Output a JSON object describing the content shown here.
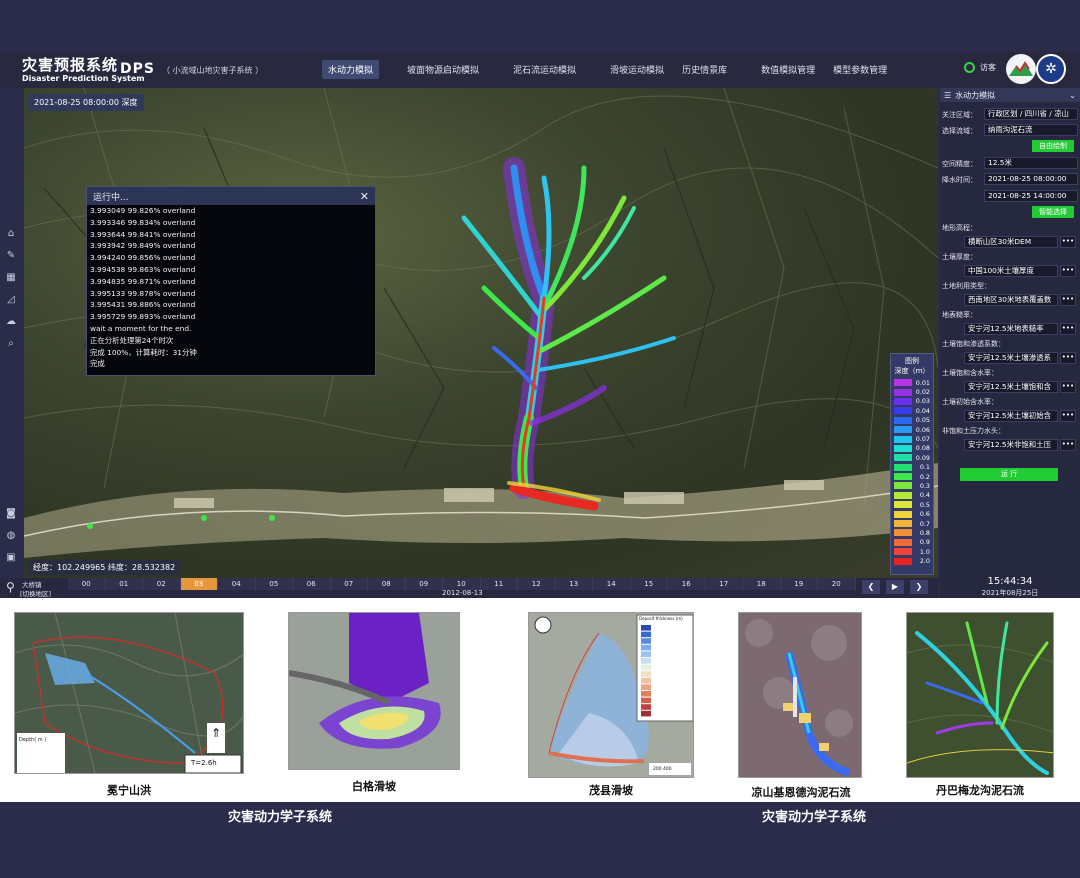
{
  "header": {
    "brand_cn": "灾害预报系统",
    "brand_en": "Disaster Prediction System",
    "product": "DPS",
    "subsystem": "（ 小流域山地灾害子系统 ）",
    "nav": [
      "水动力模拟",
      "坡面物源启动模拟",
      "泥石流运动模拟",
      "滑坡运动模拟",
      "历史情景库",
      "数值模拟管理",
      "模型参数管理"
    ],
    "user": "访客"
  },
  "map": {
    "timestamp": "2021-08-25 08:00:00  深度",
    "coords": "经度：102.249965   纬度：28.532382"
  },
  "console": {
    "title": "运行中...",
    "close": "✕",
    "lines": [
      "3.993049 99.826% overland",
      "3.993346 99.834% overland",
      "3.993644 99.841% overland",
      "3.993942 99.849% overland",
      "3.994240 99.856% overland",
      "3.994538 99.863% overland",
      "3.994835 99.871% overland",
      "3.995133 99.878% overland",
      "3.995431 99.886% overland",
      "3.995729 99.893% overland",
      "wait a moment for the end.",
      "正在分析处理第24个时次",
      "完成 100%，计算耗时：31分钟",
      "完成"
    ]
  },
  "legend": {
    "title": "图例",
    "unit": "深度（m）",
    "items": [
      {
        "label": "0.01",
        "color": "#b833e6"
      },
      {
        "label": "0.02",
        "color": "#9a2fe8"
      },
      {
        "label": "0.03",
        "color": "#6a30ee"
      },
      {
        "label": "0.04",
        "color": "#3a3af0"
      },
      {
        "label": "0.05",
        "color": "#2a6af2"
      },
      {
        "label": "0.06",
        "color": "#2a9af2"
      },
      {
        "label": "0.07",
        "color": "#22c4f0"
      },
      {
        "label": "0.08",
        "color": "#1ee0d0"
      },
      {
        "label": "0.09",
        "color": "#1ee0a0"
      },
      {
        "label": "0.1",
        "color": "#22e070"
      },
      {
        "label": "0.2",
        "color": "#3ee84a"
      },
      {
        "label": "0.3",
        "color": "#7ee83a"
      },
      {
        "label": "0.4",
        "color": "#b6e83a"
      },
      {
        "label": "0.5",
        "color": "#dfe63a"
      },
      {
        "label": "0.6",
        "color": "#f0d23a"
      },
      {
        "label": "0.7",
        "color": "#f2b43a"
      },
      {
        "label": "0.8",
        "color": "#f2903a"
      },
      {
        "label": "0.9",
        "color": "#f26a3a"
      },
      {
        "label": "1.0",
        "color": "#f0443a"
      },
      {
        "label": "2.0",
        "color": "#e62222"
      }
    ]
  },
  "timeline": {
    "layer_switch_1": "大桥镇",
    "layer_switch_2": "[切换地区]",
    "ticks": [
      "00",
      "01",
      "02",
      "03",
      "04",
      "05",
      "06",
      "07",
      "08",
      "09",
      "10",
      "11",
      "12",
      "13",
      "14",
      "15",
      "16",
      "17",
      "18",
      "19",
      "20"
    ],
    "active_index": 3,
    "date": "2012-08-13",
    "prev": "❮",
    "play": "▶",
    "next": "❯"
  },
  "panel": {
    "title": "水动力模拟",
    "caret": "⌄",
    "focus_area_label": "关注区域：",
    "focus_area_value": "行政区划 / 四川省 / 凉山",
    "basin_label": "选择流域：",
    "basin_value": "纳雨沟泥石流",
    "auto_draw": "自由绘制",
    "resolution_label": "空间精度：",
    "resolution_value": "12.5米",
    "rain_time_label": "降水时间：",
    "rain_start": "2021-08-25 08:00:00",
    "rain_end": "2021-08-25 14:00:00",
    "smart_select": "智能选择",
    "dem_label": "地形高程：",
    "dem_value": "横断山区30米DEM",
    "soil_depth_label": "土壤厚度：",
    "soil_depth_value": "中国100米土壤厚度",
    "landuse_label": "土地利用类型：",
    "landuse_value": "西南地区30米地表覆盖数",
    "roughness_label": "地表糙率：",
    "roughness_value": "安宁河12.5米地表糙率",
    "conductivity_label": "土壤饱和渗透系数：",
    "conductivity_value": "安宁河12.5米土壤渗透系",
    "sat_moisture_label": "土壤饱和含水率：",
    "sat_moisture_value": "安宁河12.5米土壤饱和含",
    "init_moisture_label": "土壤初始含水率：",
    "init_moisture_value": "安宁河12.5米土壤初始含",
    "suction_label": "非饱和土压力水头：",
    "suction_value": "安宁河12.5米非饱和土压",
    "more": "•••",
    "run": "运 行",
    "clock": "15:44:34",
    "clock_date": "2021年08月25日"
  },
  "gallery": {
    "captions": [
      "冕宁山洪",
      "白格滑坡",
      "茂县滑坡",
      "凉山基恩德沟泥石流",
      "丹巴梅龙沟泥石流"
    ],
    "thumb1_legend_title": "Depth( m )",
    "thumb1_time": "T=2.6h",
    "thumb3_legend_title": "Deposit thickness (m)",
    "thumb3_scale": "200   400",
    "footer_left": "灾害动力学子系统",
    "footer_right": "灾害动力学子系统"
  }
}
